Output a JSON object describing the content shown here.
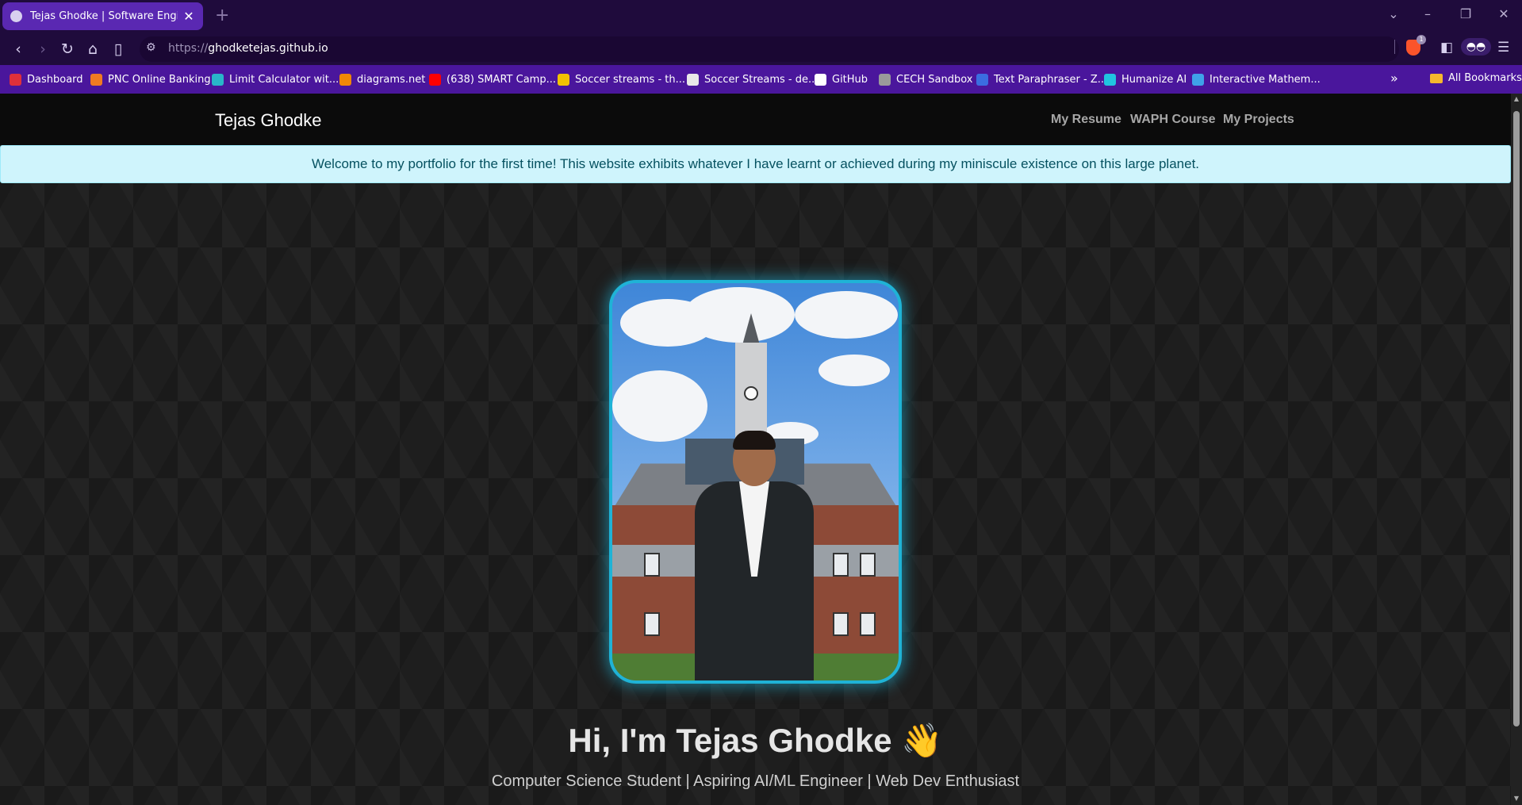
{
  "browser": {
    "tab_title": "Tejas Ghodke | Software Enginee",
    "tab_close": "✕",
    "new_tab": "+",
    "url_scheme": "https://",
    "url_host": "ghodketejas.github.io",
    "brave_badge": "1"
  },
  "bookmarks": [
    {
      "label": "Dashboard",
      "color": "#e0303a"
    },
    {
      "label": "PNC Online Banking",
      "color": "#f07b21"
    },
    {
      "label": "Limit Calculator wit...",
      "color": "#29b6c9"
    },
    {
      "label": "diagrams.net",
      "color": "#f08705"
    },
    {
      "label": "(638) SMART Camp...",
      "color": "#ff0000"
    },
    {
      "label": "Soccer streams - th...",
      "color": "#f2c200"
    },
    {
      "label": "Soccer Streams - de...",
      "color": "#e8e8e8"
    },
    {
      "label": "GitHub",
      "color": "#ffffff"
    },
    {
      "label": "CECH Sandbox",
      "color": "#9a9a9a"
    },
    {
      "label": "Text Paraphraser - Z...",
      "color": "#3b6de0"
    },
    {
      "label": "Humanize AI",
      "color": "#20c4e0"
    },
    {
      "label": "Interactive Mathem...",
      "color": "#3fa2e8"
    }
  ],
  "bookmarks_all": "All Bookmarks",
  "site": {
    "brand": "Tejas Ghodke",
    "nav": [
      "My Resume",
      "WAPH Course",
      "My Projects"
    ],
    "alert": "Welcome to my portfolio for the first time! This website exhibits whatever I have learnt or achieved during my miniscule existence on this large planet.",
    "hero_title": "Hi, I'm Tejas Ghodke 👋",
    "hero_subtitle": "Computer Science Student | Aspiring AI/ML Engineer | Web Dev Enthusiast"
  },
  "colors": {
    "accent": "#1fb3d6",
    "alert_bg": "#cff4fc",
    "alert_text": "#055160",
    "bookmarks_bar": "#4a169c",
    "tab_active": "#5a28b2"
  }
}
